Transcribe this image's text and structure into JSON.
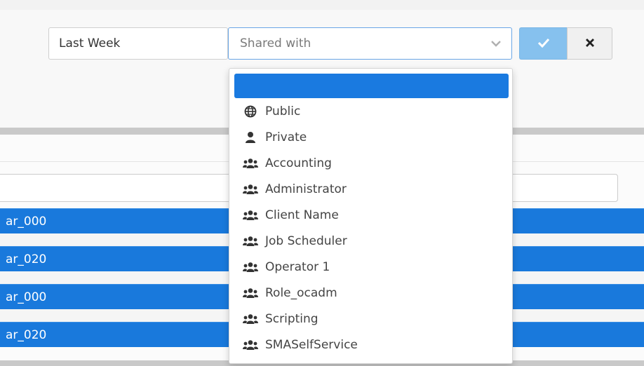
{
  "toolbar": {
    "date_range_value": "Last Week",
    "shared_with_placeholder": "Shared with"
  },
  "rows": [
    {
      "label": "ar_000"
    },
    {
      "label": "ar_020"
    },
    {
      "label": "ar_000"
    },
    {
      "label": "ar_020"
    }
  ],
  "dropdown": {
    "options": [
      {
        "label": "Public",
        "icon": "globe-icon"
      },
      {
        "label": "Private",
        "icon": "user-icon"
      },
      {
        "label": "Accounting",
        "icon": "users-icon"
      },
      {
        "label": "Administrator",
        "icon": "users-icon"
      },
      {
        "label": "Client Name",
        "icon": "users-icon"
      },
      {
        "label": "Job Scheduler",
        "icon": "users-icon"
      },
      {
        "label": "Operator 1",
        "icon": "users-icon"
      },
      {
        "label": "Role_ocadm",
        "icon": "users-icon"
      },
      {
        "label": "Scripting",
        "icon": "users-icon"
      },
      {
        "label": "SMASelfService",
        "icon": "users-icon"
      }
    ]
  },
  "colors": {
    "accent": "#1a7ae0",
    "confirm_button": "#86c1ee",
    "row_highlight": "#1979dc"
  }
}
